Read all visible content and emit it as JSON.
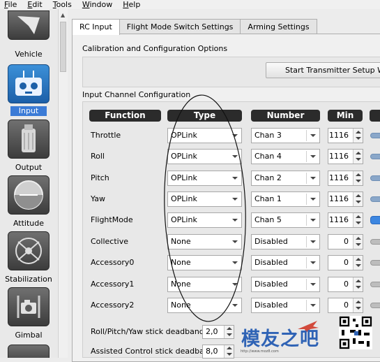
{
  "menu": [
    {
      "underline": "F",
      "rest": "ile"
    },
    {
      "underline": "E",
      "rest": "dit"
    },
    {
      "underline": "T",
      "rest": "ools"
    },
    {
      "underline": "W",
      "rest": "indow"
    },
    {
      "underline": "H",
      "rest": "elp"
    }
  ],
  "sidebar": {
    "items": [
      {
        "label": "Vehicle",
        "icon": "vehicle-icon",
        "active": false
      },
      {
        "label": "Input",
        "icon": "rc-transmitter-icon",
        "active": true
      },
      {
        "label": "Output",
        "icon": "motor-icon",
        "active": false
      },
      {
        "label": "Attitude",
        "icon": "attitude-icon",
        "active": false
      },
      {
        "label": "Stabilization",
        "icon": "stabilization-icon",
        "active": false
      },
      {
        "label": "Gimbal",
        "icon": "camera-icon",
        "active": false
      }
    ]
  },
  "tabs": [
    "RC Input",
    "Flight Mode Switch Settings",
    "Arming Settings"
  ],
  "calibration": {
    "title": "Calibration and Configuration Options",
    "wizard_button": "Start Transmitter Setup Wiza"
  },
  "channels": {
    "title": "Input Channel Configuration",
    "headers": {
      "function": "Function",
      "type": "Type",
      "number": "Number",
      "min": "Min"
    },
    "rows": [
      {
        "function": "Throttle",
        "type": "OPLink",
        "number": "Chan 3",
        "min": "1116",
        "slider": "on"
      },
      {
        "function": "Roll",
        "type": "OPLink",
        "number": "Chan 4",
        "min": "1116",
        "slider": "on"
      },
      {
        "function": "Pitch",
        "type": "OPLink",
        "number": "Chan 2",
        "min": "1116",
        "slider": "on"
      },
      {
        "function": "Yaw",
        "type": "OPLink",
        "number": "Chan 1",
        "min": "1116",
        "slider": "on"
      },
      {
        "function": "FlightMode",
        "type": "OPLink",
        "number": "Chan 5",
        "min": "1116",
        "slider": "hi"
      },
      {
        "function": "Collective",
        "type": "None",
        "number": "Disabled",
        "min": "0",
        "slider": "off"
      },
      {
        "function": "Accessory0",
        "type": "None",
        "number": "Disabled",
        "min": "0",
        "slider": "off"
      },
      {
        "function": "Accessory1",
        "type": "None",
        "number": "Disabled",
        "min": "0",
        "slider": "off"
      },
      {
        "function": "Accessory2",
        "type": "None",
        "number": "Disabled",
        "min": "0",
        "slider": "off"
      }
    ]
  },
  "deadband": {
    "rpy_label": "Roll/Pitch/Yaw stick deadband",
    "rpy_value": "2,0",
    "assisted_label": "Assisted Control stick deadband",
    "assisted_value": "8,0"
  },
  "watermark": {
    "text": "模友之吧",
    "url": "http://www.moz8.com"
  }
}
